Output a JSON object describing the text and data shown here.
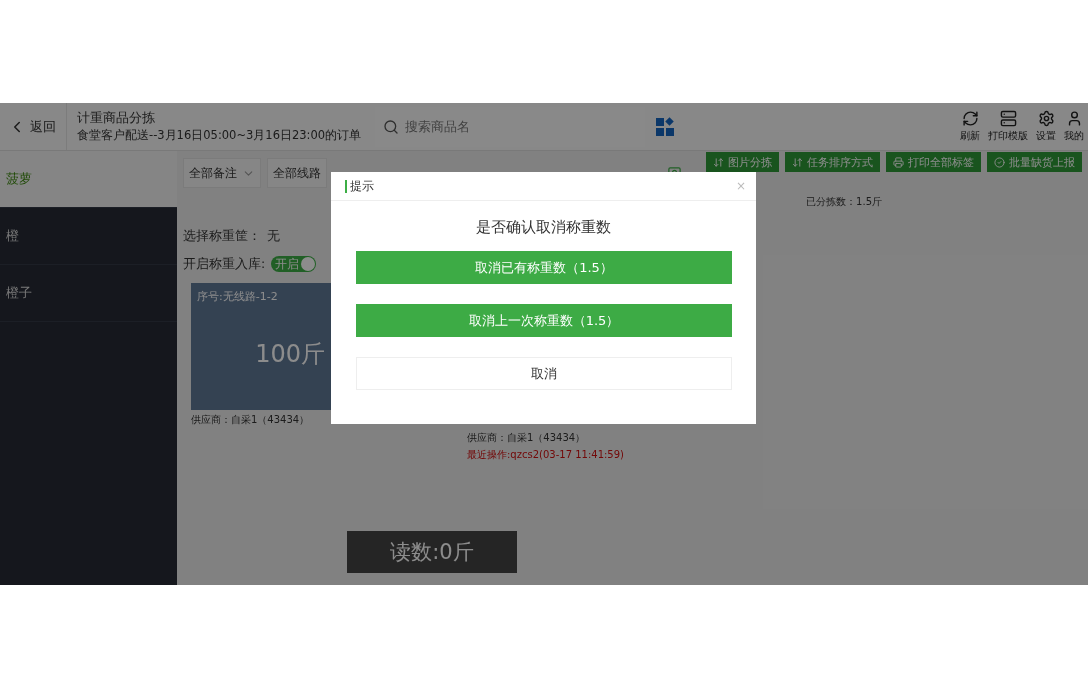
{
  "header": {
    "back": "返回",
    "title": "计重商品分拣",
    "subtitle": "食堂客户配送--3月16日05:00~3月16日23:00的订单",
    "search": {
      "placeholder": "搜索商品名"
    },
    "actions": [
      {
        "kind": "refresh",
        "label": "刷新"
      },
      {
        "kind": "print",
        "label": "打印模版"
      },
      {
        "kind": "settings",
        "label": "设置"
      },
      {
        "kind": "user",
        "label": "我的"
      }
    ]
  },
  "sidebar": {
    "items": [
      {
        "label": "菠萝",
        "selected": true
      },
      {
        "label": "橙",
        "selected": false
      },
      {
        "label": "橙子",
        "selected": false
      }
    ]
  },
  "toolbar": {
    "filters": [
      {
        "label": "全部备注",
        "caret": true
      },
      {
        "label": "全部线路",
        "caret": false
      }
    ],
    "buttons": [
      {
        "kind": "sort",
        "label": "图片分拣"
      },
      {
        "kind": "sort",
        "label": "任务排序方式"
      },
      {
        "kind": "print",
        "label": "打印全部标签"
      },
      {
        "kind": "report",
        "label": "批量缺货上报"
      }
    ]
  },
  "main": {
    "sorted_count": "已分拣数：1.5斤",
    "basket": {
      "label": "选择称重筐：",
      "value": "无"
    },
    "stock_in": {
      "label": "开启称重入库:",
      "toggle_text": "开启",
      "on": true
    },
    "cards": [
      {
        "kind": "tile",
        "seq": "序号:无线路-1-2",
        "weight": "100斤",
        "supplier": "供应商：自采1（43434）"
      },
      {
        "kind": "caption",
        "supplier": "供应商：自采1（43434）",
        "last_op": "最近操作:qzcs2(03-17 11:41:59)"
      }
    ],
    "reading": "读数:0斤"
  },
  "dialog": {
    "title": "提示",
    "close": "×",
    "message": "是否确认取消称重数",
    "buttons": [
      {
        "kind": "primary",
        "label": "取消已有称重数（1.5）"
      },
      {
        "kind": "primary",
        "label": "取消上一次称重数（1.5）"
      },
      {
        "kind": "default",
        "label": "取消"
      }
    ]
  }
}
